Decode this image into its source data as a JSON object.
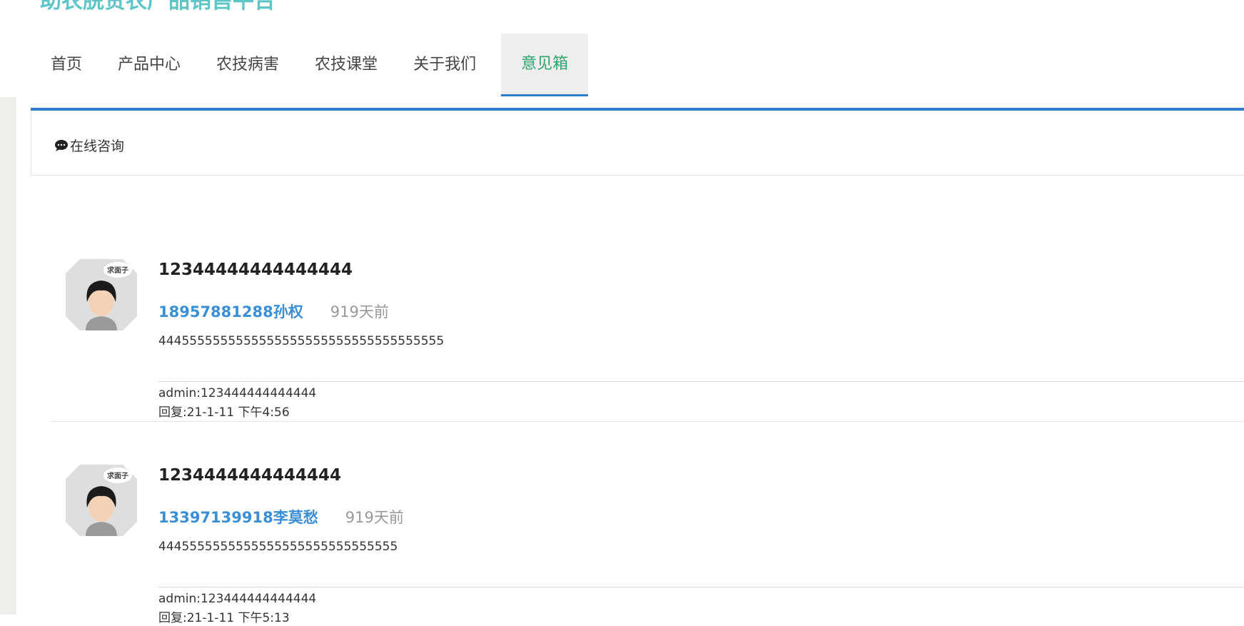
{
  "header": {
    "site_title": "助农脱贫农产品销售平台"
  },
  "nav": [
    {
      "label": "首页",
      "active": false
    },
    {
      "label": "产品中心",
      "active": false
    },
    {
      "label": "农技病害",
      "active": false
    },
    {
      "label": "农技课堂",
      "active": false
    },
    {
      "label": "关于我们",
      "active": false
    },
    {
      "label": "意见箱",
      "active": true
    }
  ],
  "consult": {
    "icon": "chat-bubble-icon",
    "label": "在线咨询"
  },
  "avatar_badge": "求面子",
  "messages": [
    {
      "title": "12344444444444444",
      "user": "18957881288孙权",
      "time_ago": "919天前",
      "content": "4445555555555555555555555555555555555",
      "reply_admin": "admin:123444444444444",
      "reply_time": "回复:21-1-11 下午4:56"
    },
    {
      "title": "1234444444444444",
      "user": "13397139918李莫愁",
      "time_ago": "919天前",
      "content": "4445555555555555555555555555555",
      "reply_admin": "admin:123444444444444",
      "reply_time": "回复:21-1-11 下午5:13"
    }
  ],
  "colors": {
    "title": "#5ec6c6",
    "nav_active_text": "#2fa56e",
    "accent_blue": "#2f7ccd",
    "user_link": "#3b8fd6"
  }
}
